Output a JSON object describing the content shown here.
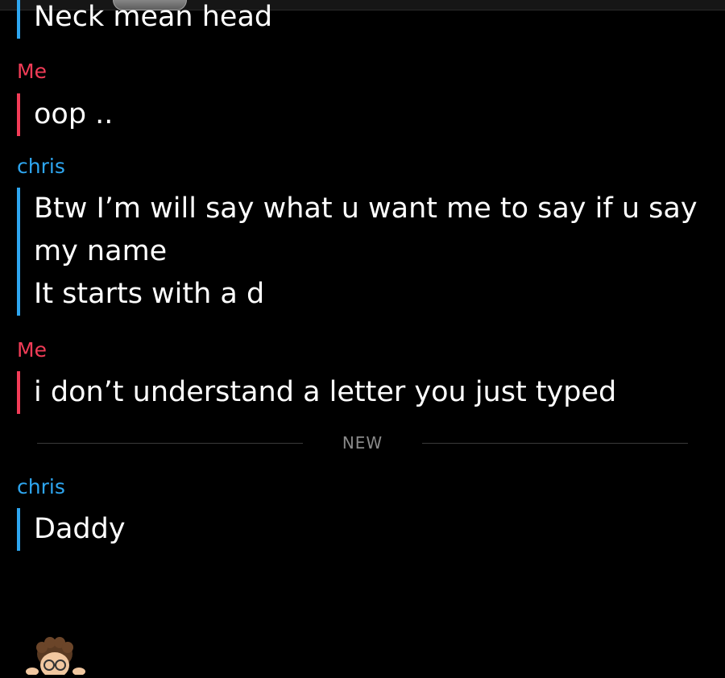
{
  "messages": [
    {
      "sender": "",
      "sender_type": "chris",
      "lines": [
        "Neck mean head"
      ]
    },
    {
      "sender": "Me",
      "sender_type": "me",
      "lines": [
        "oop .."
      ]
    },
    {
      "sender": "chris",
      "sender_type": "chris",
      "lines": [
        "Btw I’m will say what u want me to say if u say",
        "my name",
        "It starts with a d"
      ]
    },
    {
      "sender": "Me",
      "sender_type": "me",
      "lines": [
        "i don’t understand a letter you just typed"
      ]
    },
    {
      "sender": "chris",
      "sender_type": "chris",
      "lines": [
        "Daddy"
      ]
    }
  ],
  "divider": {
    "label": "NEW"
  },
  "colors": {
    "me_accent": "#f23c57",
    "chris_accent": "#2ea6f0",
    "background": "#000000",
    "text": "#ffffff"
  },
  "icons": {
    "top_avatar": "friend-avatar-icon",
    "bottom_avatar": "bitmoji-avatar-icon"
  }
}
